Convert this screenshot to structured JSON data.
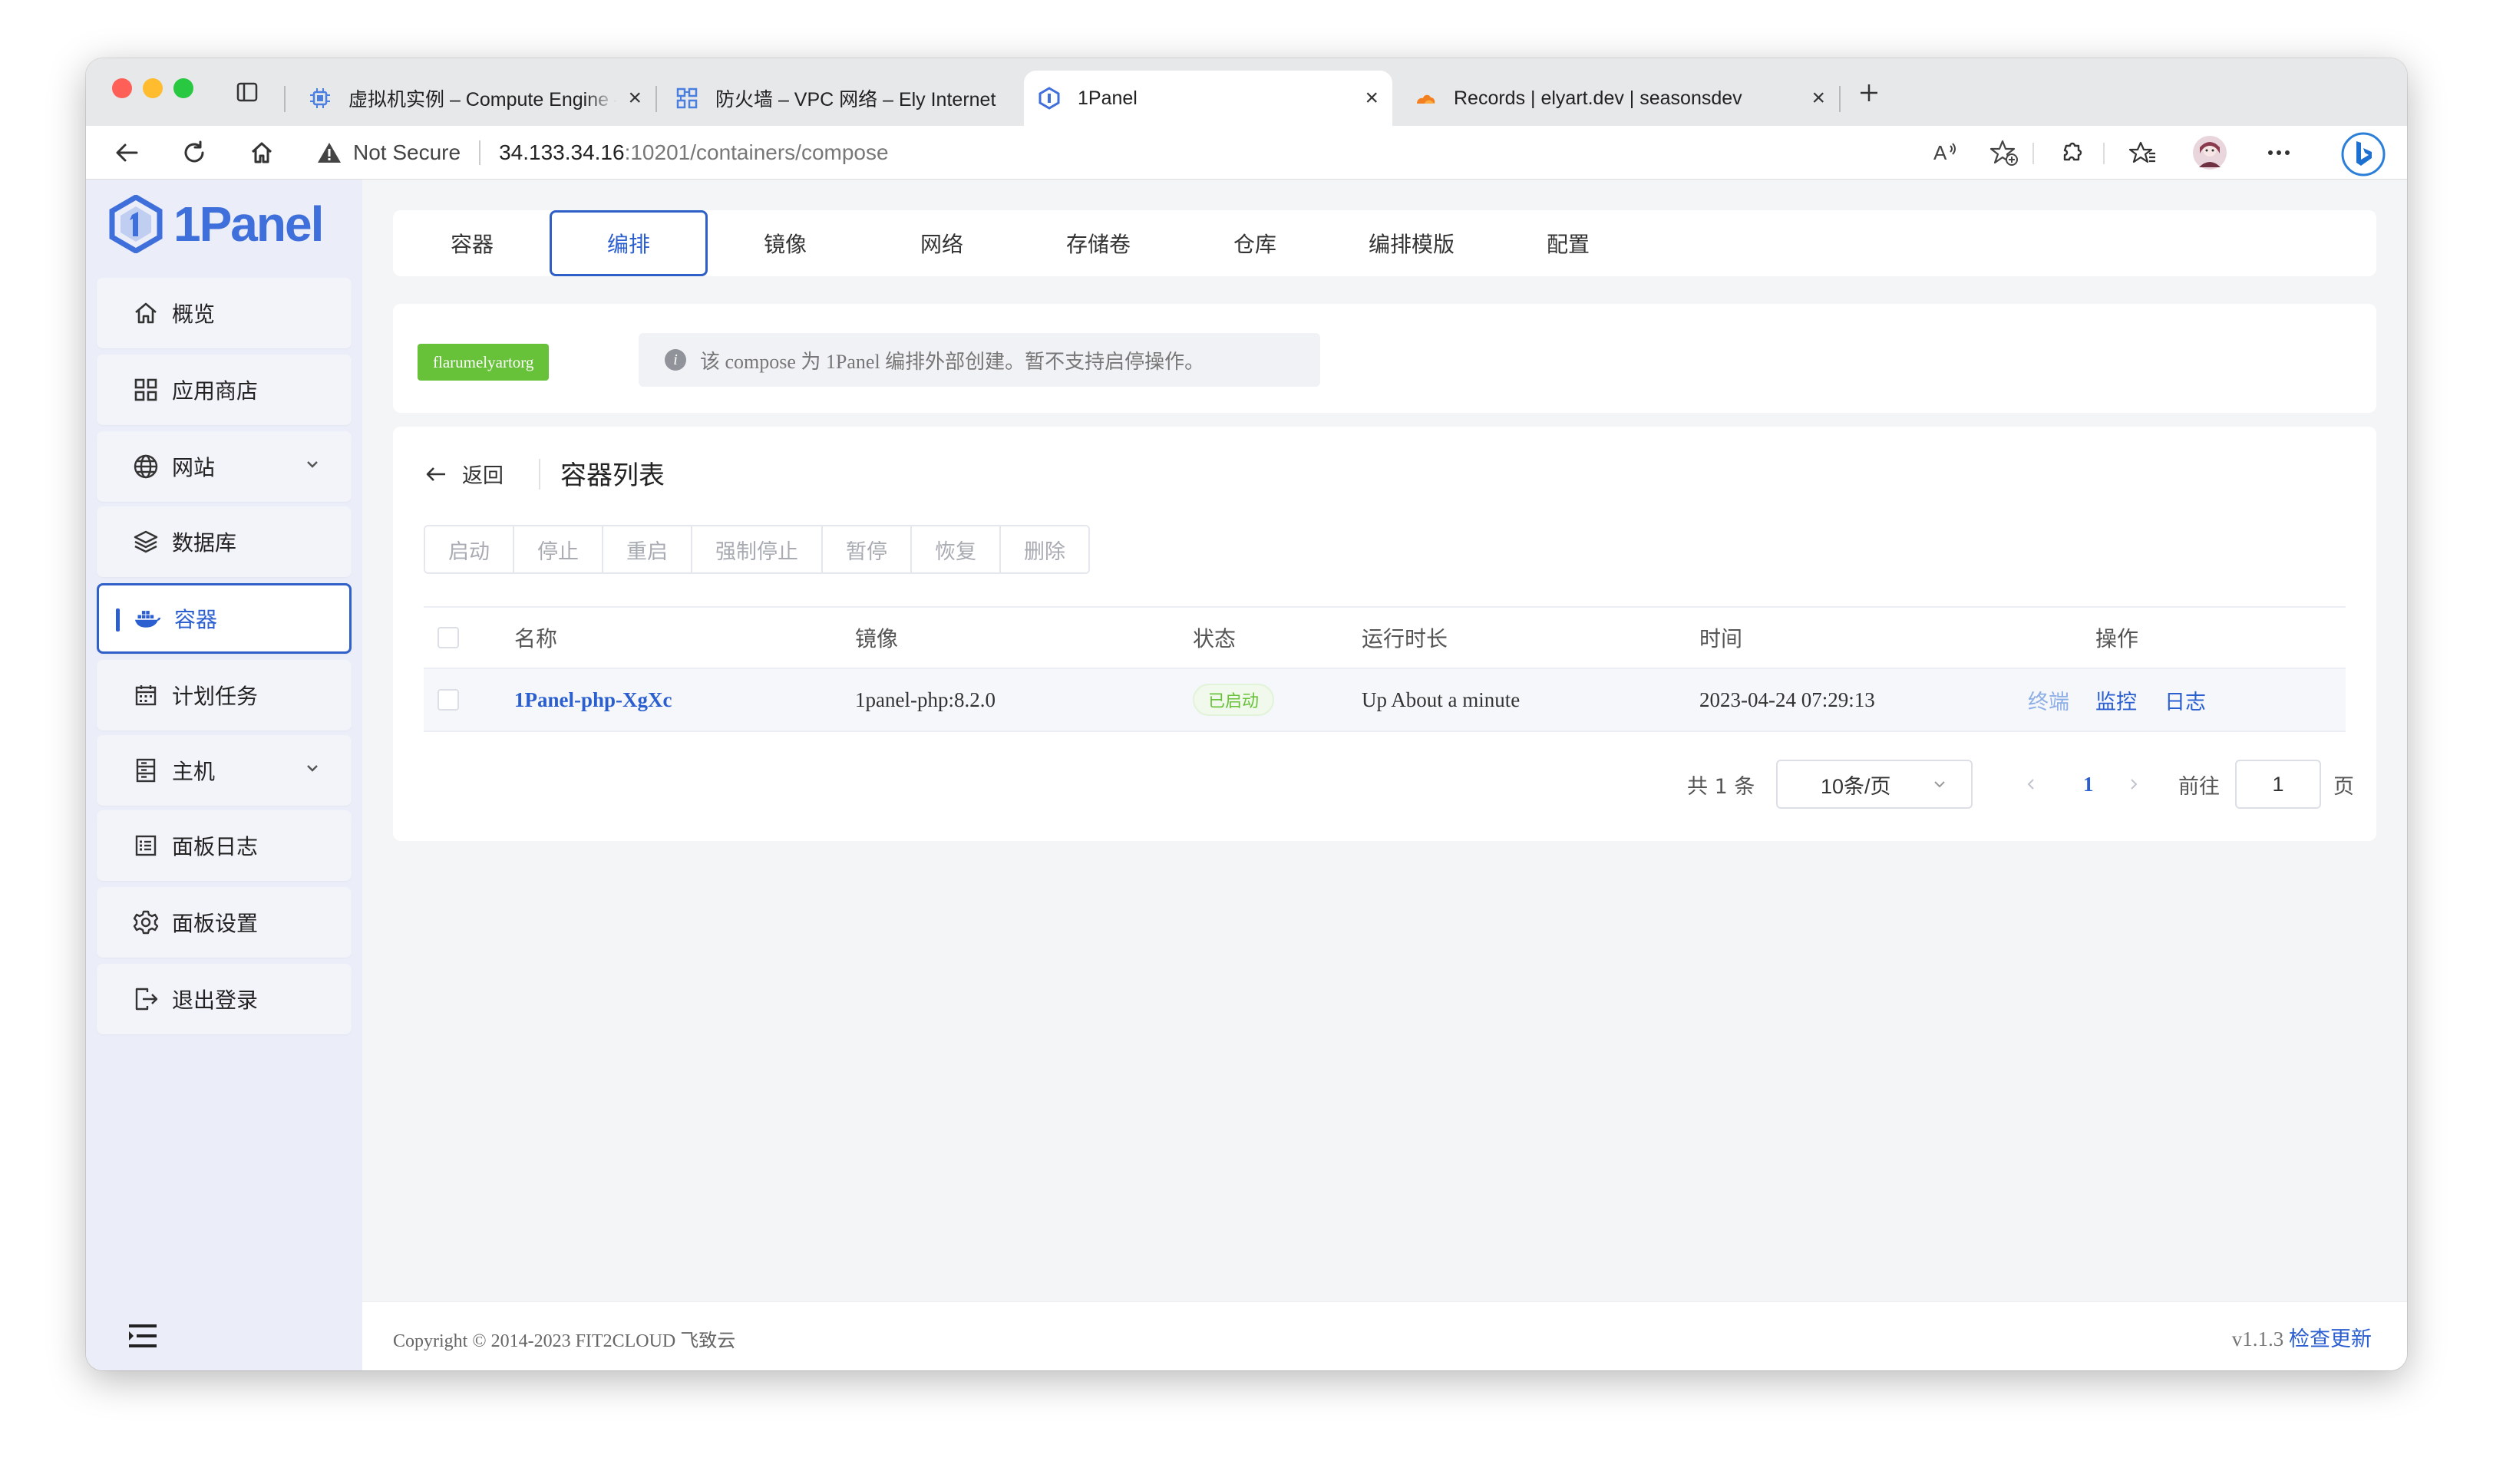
{
  "browser": {
    "tabs": [
      {
        "title": "虚拟机实例 – Compute Engine – Ely Internet",
        "favicon": "compute-engine-icon"
      },
      {
        "title": "防火墙 – VPC 网络 – Ely Internet",
        "favicon": "vpc-network-icon"
      },
      {
        "title": "1Panel",
        "favicon": "1panel-icon",
        "active": true
      },
      {
        "title": "Records | elyart.dev | seasonsdev",
        "favicon": "cloudflare-icon"
      }
    ],
    "security_label": "Not Secure",
    "url_host": "34.133.34.16",
    "url_rest": ":10201/containers/compose",
    "colors": {
      "tabbar": "#e7e8ea",
      "accent": "#2b5fd0"
    }
  },
  "brand": {
    "name": "1Panel",
    "color": "#3f6fda"
  },
  "sidebar": {
    "items": [
      {
        "label": "概览",
        "icon": "home-icon"
      },
      {
        "label": "应用商店",
        "icon": "grid-icon"
      },
      {
        "label": "网站",
        "icon": "globe-icon",
        "has_submenu": true
      },
      {
        "label": "数据库",
        "icon": "layers-icon"
      },
      {
        "label": "容器",
        "icon": "docker-icon",
        "active": true
      },
      {
        "label": "计划任务",
        "icon": "calendar-icon"
      },
      {
        "label": "主机",
        "icon": "server-icon",
        "has_submenu": true
      },
      {
        "label": "面板日志",
        "icon": "log-list-icon"
      },
      {
        "label": "面板设置",
        "icon": "gear-icon"
      },
      {
        "label": "退出登录",
        "icon": "logout-icon"
      }
    ]
  },
  "page_tabs": [
    "容器",
    "编排",
    "镜像",
    "网络",
    "存储卷",
    "仓库",
    "编排模版",
    "配置"
  ],
  "active_page_tab": "编排",
  "compose": {
    "name": "flarumelyartorg",
    "notice": "该 compose 为 1Panel 编排外部创建。暂不支持启停操作。"
  },
  "container_list": {
    "back_label": "返回",
    "title": "容器列表",
    "actions": [
      "启动",
      "停止",
      "重启",
      "强制停止",
      "暂停",
      "恢复",
      "删除"
    ],
    "columns": [
      "名称",
      "镜像",
      "状态",
      "运行时长",
      "时间",
      "操作"
    ],
    "rows": [
      {
        "name": "1Panel-php-XgXc",
        "image": "1panel-php:8.2.0",
        "status": "已启动",
        "uptime": "Up About a minute",
        "time": "2023-04-24 07:29:13",
        "ops": [
          "终端",
          "监控",
          "日志"
        ]
      }
    ]
  },
  "pagination": {
    "total_label": "共 1 条",
    "page_size": "10条/页",
    "current_page": "1",
    "goto_label": "前往",
    "goto_value": "1",
    "page_suffix": "页"
  },
  "footer": {
    "copyright": "Copyright © 2014-2023 FIT2CLOUD 飞致云",
    "version": "v1.1.3",
    "update_label": "检查更新"
  }
}
